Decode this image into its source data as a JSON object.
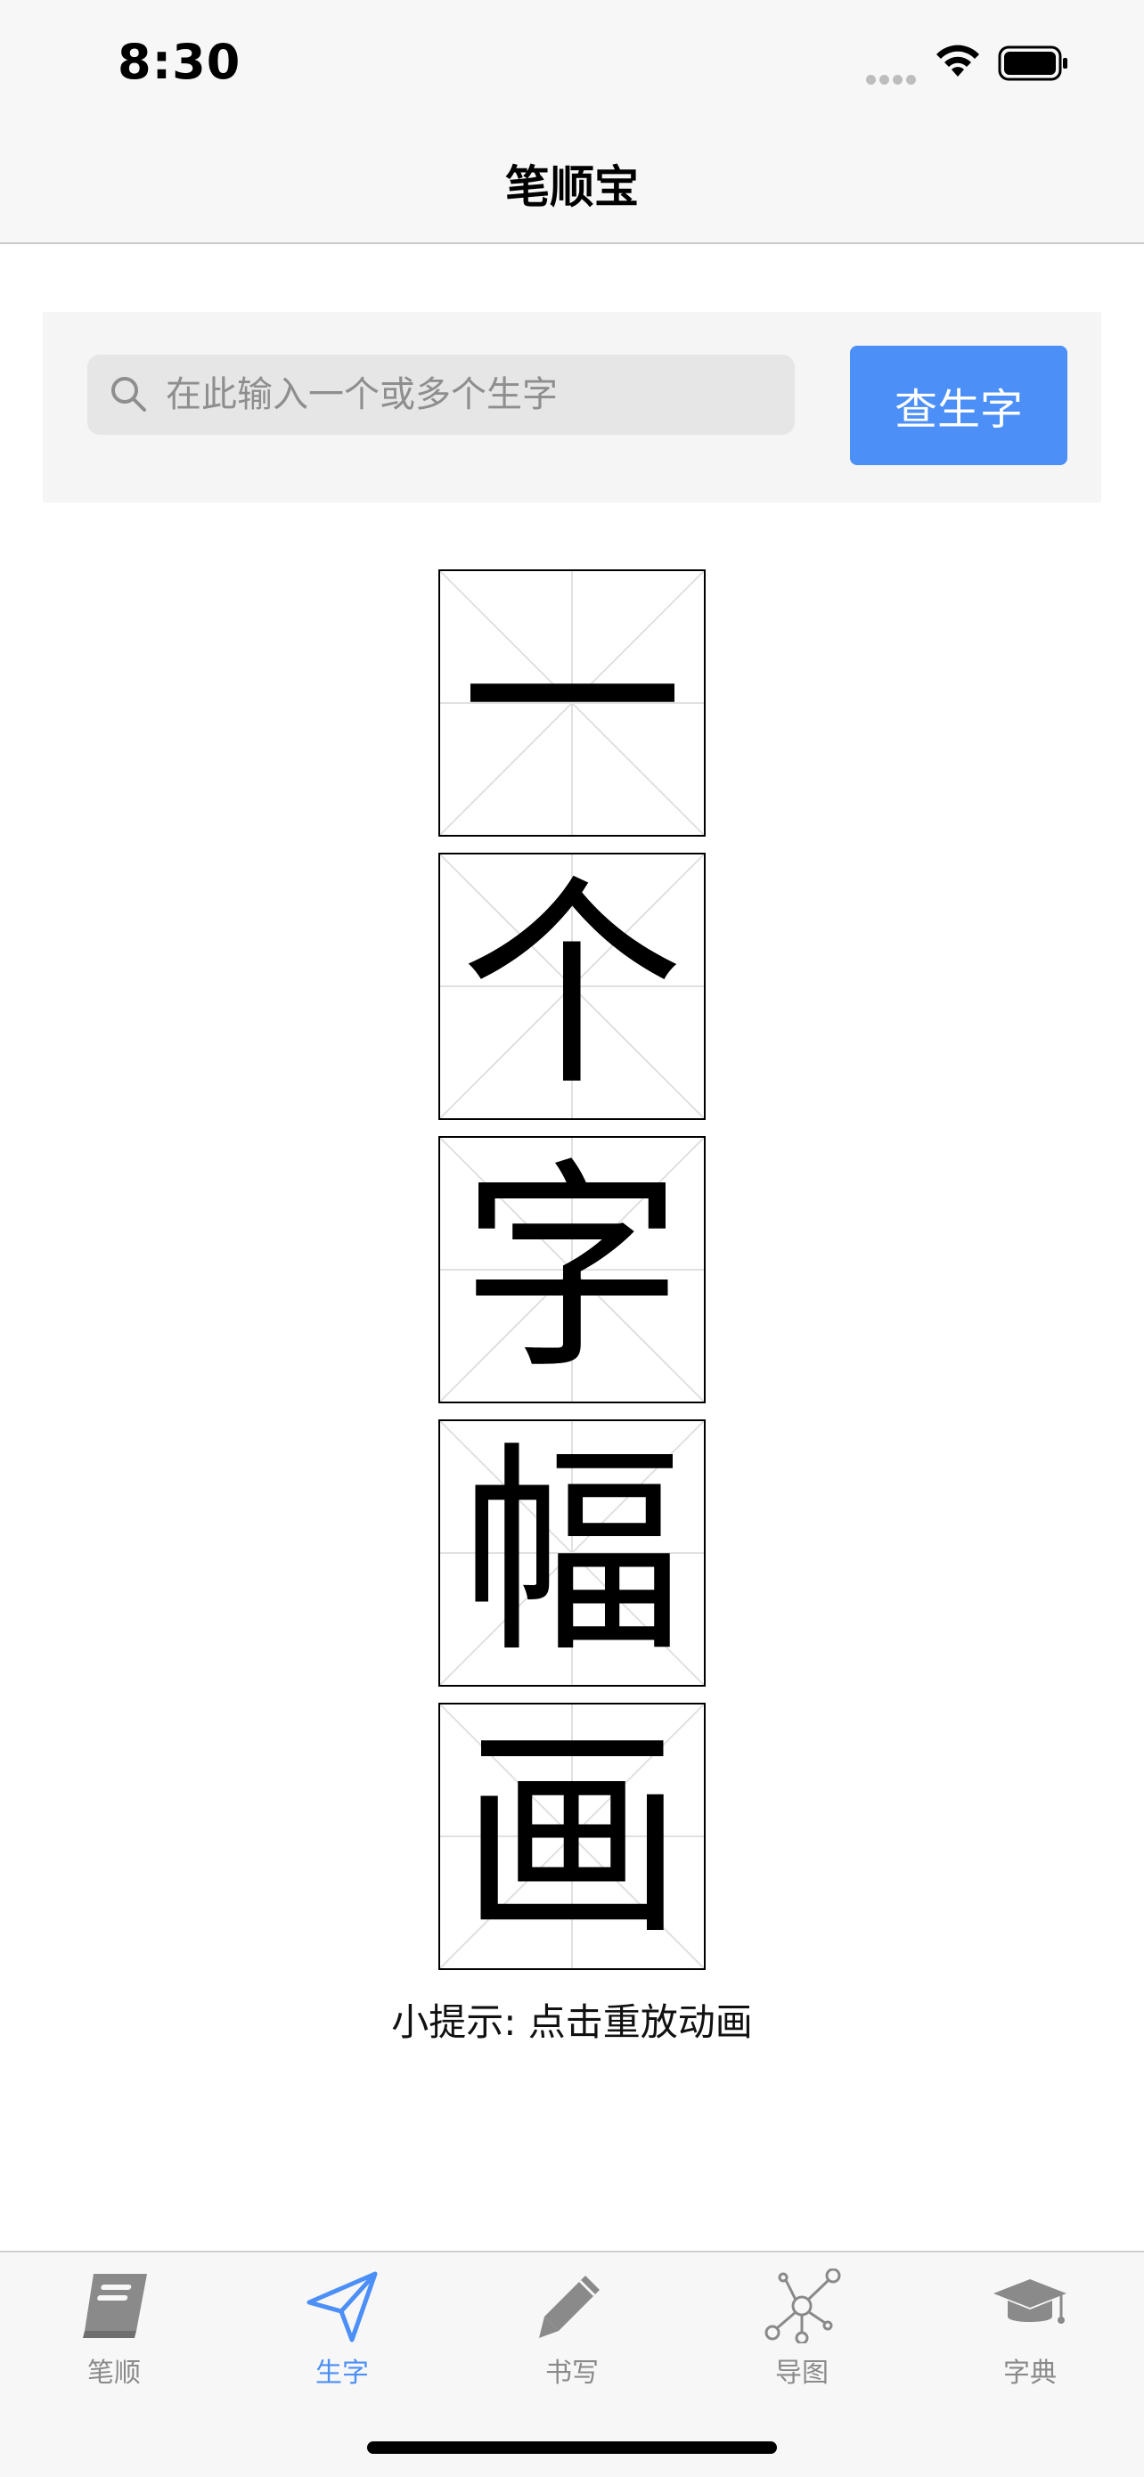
{
  "status_bar": {
    "time": "8:30"
  },
  "nav": {
    "title": "笔顺宝"
  },
  "search": {
    "placeholder": "在此输入一个或多个生字",
    "value": "",
    "button_label": "查生字"
  },
  "characters": [
    "一",
    "个",
    "字",
    "幅",
    "画"
  ],
  "hint": "小提示: 点击重放动画",
  "tabs": [
    {
      "label": "笔顺",
      "icon": "book-icon",
      "active": false
    },
    {
      "label": "生字",
      "icon": "paper-plane-icon",
      "active": true
    },
    {
      "label": "书写",
      "icon": "pencil-icon",
      "active": false
    },
    {
      "label": "导图",
      "icon": "mind-map-icon",
      "active": false
    },
    {
      "label": "字典",
      "icon": "graduation-cap-icon",
      "active": false
    }
  ],
  "colors": {
    "accent": "#4b8ff7",
    "inactive": "#8a8a8a"
  }
}
